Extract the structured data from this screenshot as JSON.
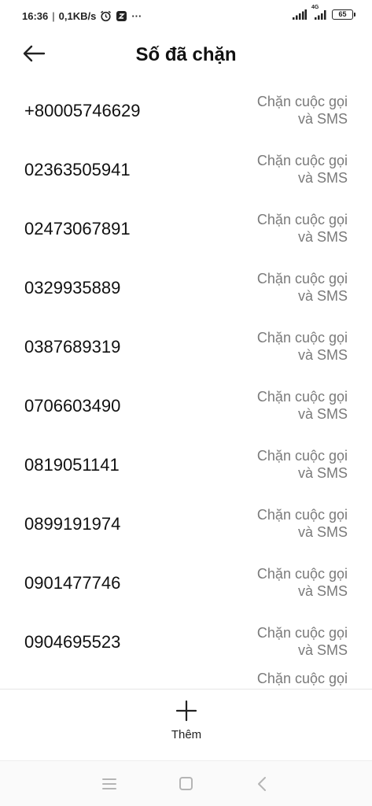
{
  "status_bar": {
    "time": "16:36",
    "separator": "|",
    "speed": "0,1KB/s",
    "more": "···",
    "network": "4G",
    "battery": "65"
  },
  "header": {
    "title": "Số đã chặn"
  },
  "blocked_numbers": [
    {
      "number": "+80005746629",
      "mode_line1": "Chặn cuộc gọi",
      "mode_line2": "và SMS"
    },
    {
      "number": "02363505941",
      "mode_line1": "Chặn cuộc gọi",
      "mode_line2": "và SMS"
    },
    {
      "number": "02473067891",
      "mode_line1": "Chặn cuộc gọi",
      "mode_line2": "và SMS"
    },
    {
      "number": "0329935889",
      "mode_line1": "Chặn cuộc gọi",
      "mode_line2": "và SMS"
    },
    {
      "number": "0387689319",
      "mode_line1": "Chặn cuộc gọi",
      "mode_line2": "và SMS"
    },
    {
      "number": "0706603490",
      "mode_line1": "Chặn cuộc gọi",
      "mode_line2": "và SMS"
    },
    {
      "number": "0819051141",
      "mode_line1": "Chặn cuộc gọi",
      "mode_line2": "và SMS"
    },
    {
      "number": "0899191974",
      "mode_line1": "Chặn cuộc gọi",
      "mode_line2": "và SMS"
    },
    {
      "number": "0901477746",
      "mode_line1": "Chặn cuộc gọi",
      "mode_line2": "và SMS"
    },
    {
      "number": "0904695523",
      "mode_line1": "Chặn cuộc gọi",
      "mode_line2": "và SMS"
    }
  ],
  "partial_row": {
    "mode_line1": "Chặn cuộc gọi"
  },
  "footer": {
    "add_label": "Thêm"
  },
  "icons": {
    "back": "arrow-left-icon",
    "add": "plus-icon",
    "alarm": "alarm-clock-icon",
    "app_notification": "app-notification-icon",
    "signal": "signal-icon",
    "battery": "battery-icon",
    "nav_menu": "menu-icon",
    "nav_home": "home-square-icon",
    "nav_back": "chevron-left-icon"
  },
  "colors": {
    "background": "#ffffff",
    "text_primary": "#111111",
    "text_secondary": "#7a7a7a",
    "divider": "#e6e6e6",
    "nav_icons": "#b5b5b5"
  }
}
